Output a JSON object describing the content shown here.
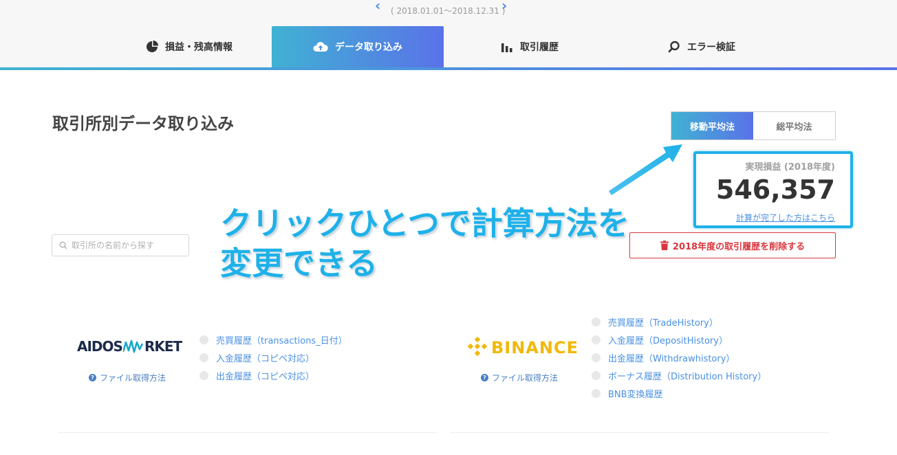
{
  "period": {
    "range": "( 2018.01.01〜2018.12.31 )"
  },
  "tabs": [
    {
      "label": "損益・残高情報",
      "icon": "pie-chart-icon"
    },
    {
      "label": "データ取り込み",
      "icon": "cloud-upload-icon",
      "active": true
    },
    {
      "label": "取引履歴",
      "icon": "bar-chart-icon"
    },
    {
      "label": "エラー検証",
      "icon": "search-icon"
    }
  ],
  "page": {
    "title": "取引所別データ取り込み"
  },
  "method_toggle": {
    "options": [
      "移動平均法",
      "総平均法"
    ],
    "selected": "移動平均法"
  },
  "profit": {
    "label": "実現損益 (2018年度)",
    "currency": "¥",
    "value": "546,357",
    "link": "計算が完了した方はこちら"
  },
  "delete_button": {
    "label": "2018年度の取引履歴を削除する"
  },
  "search": {
    "placeholder": "取引所の名前から探す"
  },
  "annotation": {
    "line1": "クリックひとつで計算方法を",
    "line2": "変更できる"
  },
  "exchanges": [
    {
      "name_left": "AIDOS",
      "name_right": "RKET",
      "how_to": "ファイル取得方法",
      "files": [
        "売買履歴（transactions_日付）",
        "入金履歴（コピペ対応）",
        "出金履歴（コピペ対応）"
      ]
    },
    {
      "name": "BINANCE",
      "how_to": "ファイル取得方法",
      "files": [
        "売買履歴（TradeHistory）",
        "入金履歴（DepositHistory）",
        "出金履歴（Withdrawhistory）",
        "ボーナス履歴（Distribution History）",
        "BNB変換履歴"
      ]
    }
  ],
  "colors": {
    "accent_start": "#40b2d3",
    "accent_end": "#5a72e8",
    "highlight": "#1fb1e8",
    "danger": "#d9363e",
    "binance": "#f0b90b"
  }
}
